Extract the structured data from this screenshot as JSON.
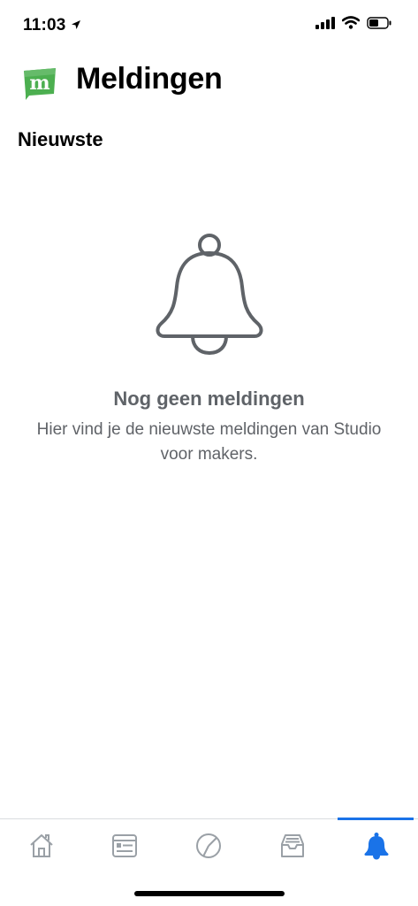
{
  "status_bar": {
    "time": "11:03"
  },
  "header": {
    "title": "Meldingen",
    "logo_letter": "m"
  },
  "section": {
    "title": "Nieuwste"
  },
  "empty_state": {
    "title": "Nog geen meldingen",
    "description": "Hier vind je de nieuwste meldingen van Studio voor makers."
  },
  "tabbar": {
    "items": [
      {
        "icon": "home-icon",
        "active": false
      },
      {
        "icon": "content-icon",
        "active": false
      },
      {
        "icon": "analytics-icon",
        "active": false
      },
      {
        "icon": "inbox-icon",
        "active": false
      },
      {
        "icon": "bell-icon",
        "active": true
      }
    ]
  },
  "colors": {
    "accent": "#1a73e8",
    "inactive_icon": "#9aa0a6",
    "logo_green": "#4caf50"
  }
}
